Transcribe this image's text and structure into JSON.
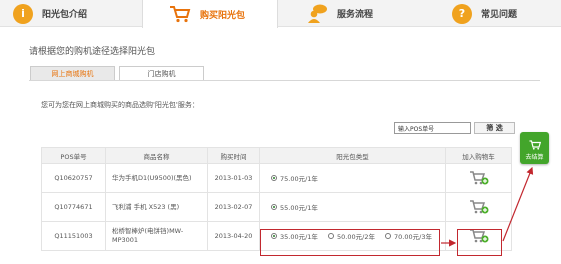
{
  "top_tabs": [
    {
      "label": "阳光包介绍",
      "icon": "info-icon",
      "active": false
    },
    {
      "label": "购买阳光包",
      "icon": "shopping-cart-icon",
      "active": true
    },
    {
      "label": "服务流程",
      "icon": "chat-person-icon",
      "active": false
    },
    {
      "label": "常见问题",
      "icon": "question-icon",
      "active": false
    }
  ],
  "section_title": "请根据您的购机途径选择阳光包",
  "sub_tabs": [
    {
      "label": "网上商城购机",
      "active": true
    },
    {
      "label": "门店购机",
      "active": false
    }
  ],
  "intro_text": "您可为您在网上商城购买的商品选购'阳光包'服务：",
  "search": {
    "placeholder": "输入POS单号",
    "button_label": "筛 选"
  },
  "table": {
    "headers": [
      "POS单号",
      "商品名称",
      "购买时间",
      "阳光包类型",
      "加入购物车"
    ],
    "rows": [
      {
        "pos": "Q10620757",
        "product": "华为手机D1(U9500)(黑色)",
        "date": "2013-01-03",
        "options": [
          {
            "label": "75.00元/1年",
            "checked": true
          }
        ]
      },
      {
        "pos": "Q10774671",
        "product": "飞利浦 手机 X523 (黑)",
        "date": "2013-02-07",
        "options": [
          {
            "label": "55.00元/1年",
            "checked": true
          }
        ]
      },
      {
        "pos": "Q11151003",
        "product": "松桥智棒炉(电饼铛)MW-MP3001",
        "date": "2013-04-20",
        "options": [
          {
            "label": "35.00元/1年",
            "checked": true
          },
          {
            "label": "50.00元/2年",
            "checked": false
          },
          {
            "label": "70.00元/3年",
            "checked": false
          }
        ]
      }
    ]
  },
  "checkout": {
    "label": "去结算",
    "icon": "shopping-cart-icon"
  },
  "colors": {
    "accent": "#e8730c",
    "highlight": "#c2282f",
    "checkout": "#43a52b"
  }
}
